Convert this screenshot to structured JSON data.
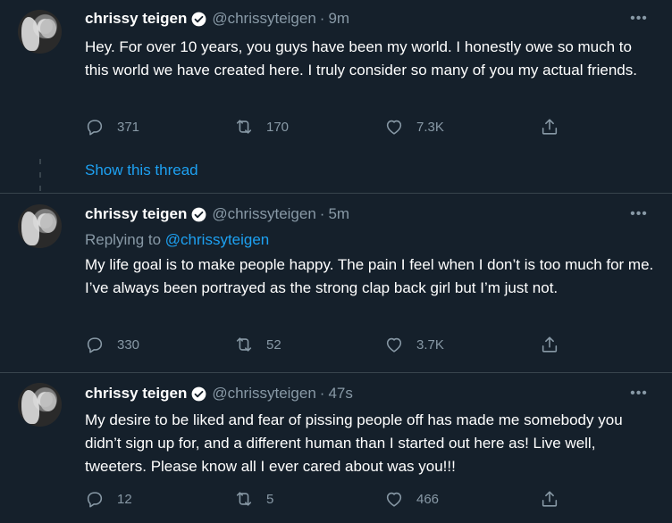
{
  "tweets": [
    {
      "name": "chrissy teigen",
      "handle": "@chrissyteigen",
      "separator": "·",
      "time": "9m",
      "replying_label": "",
      "replying_to": "",
      "text": "Hey. For over 10 years, you guys have been my world. I honestly owe so much to this world we have created here. I truly consider so many of you my actual friends.",
      "replies": "371",
      "retweets": "170",
      "likes": "7.3K"
    },
    {
      "name": "chrissy teigen",
      "handle": "@chrissyteigen",
      "separator": "·",
      "time": "5m",
      "replying_label": "Replying to",
      "replying_to": "@chrissyteigen",
      "text": "My life goal is to make people happy. The pain I feel when I don’t is too much for me. I’ve always been portrayed as the strong clap back girl but I’m just not.",
      "replies": "330",
      "retweets": "52",
      "likes": "3.7K"
    },
    {
      "name": "chrissy teigen",
      "handle": "@chrissyteigen",
      "separator": "·",
      "time": "47s",
      "replying_label": "",
      "replying_to": "",
      "text": "My desire to be liked and fear of pissing people off has made me somebody you didn’t sign up for, and a different human than I started out here as! Live well, tweeters. Please know all I ever cared about was you!!!",
      "replies": "12",
      "retweets": "5",
      "likes": "466"
    }
  ],
  "show_thread_label": "Show this thread",
  "more_glyph": "•••",
  "icons": {
    "reply": "reply-icon",
    "retweet": "retweet-icon",
    "like": "like-icon",
    "share": "share-icon",
    "verified": "verified-badge-icon",
    "more": "more-icon"
  },
  "colors": {
    "background": "#15202b",
    "text": "#ffffff",
    "secondary": "#8899a6",
    "link": "#1da1f2",
    "border": "#38444d"
  }
}
